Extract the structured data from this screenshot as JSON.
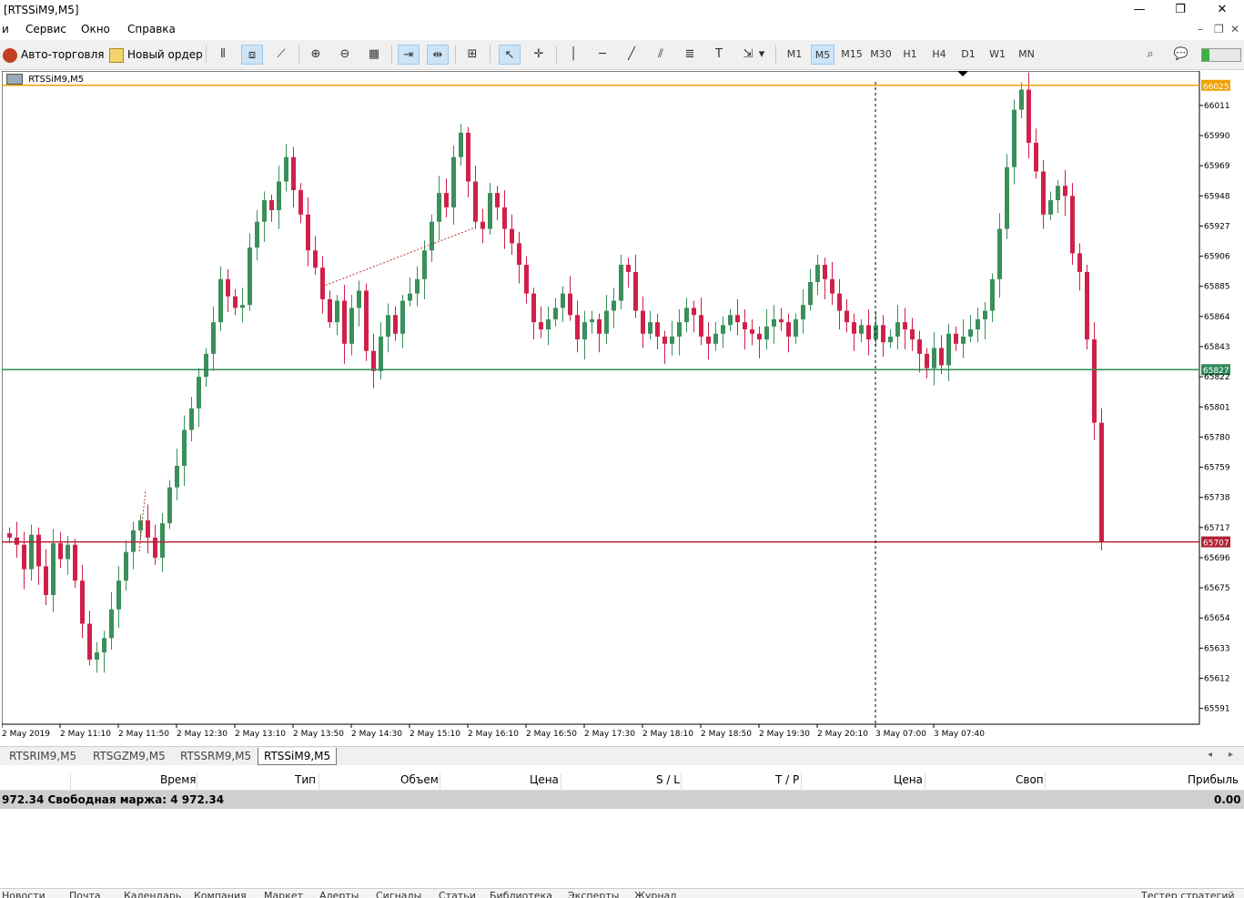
{
  "window": {
    "title": "[RTSSiM9,M5]",
    "minimize": "—",
    "restore": "❐",
    "close": "✕"
  },
  "menu": [
    "и",
    "Сервис",
    "Окно",
    "Справка"
  ],
  "toolbar": {
    "autotrade_label": "Авто-торговля",
    "new_order_label": "Новый ордер"
  },
  "timeframes": [
    "M1",
    "M5",
    "M15",
    "M30",
    "H1",
    "H4",
    "D1",
    "W1",
    "MN"
  ],
  "active_timeframe": "M5",
  "chart": {
    "symbol_label": "RTSSiM9,M5"
  },
  "chart_data": {
    "type": "candlestick",
    "ylim": [
      65580,
      66035
    ],
    "price_ticks": [
      66011,
      65990,
      65969,
      65948,
      65927,
      65906,
      65885,
      65864,
      65843,
      65822,
      65801,
      65780,
      65759,
      65738,
      65717,
      65696,
      65675,
      65654,
      65633,
      65612,
      65591
    ],
    "time_labels": [
      "2 May 2019",
      "2 May 11:10",
      "2 May 11:50",
      "2 May 12:30",
      "2 May 13:10",
      "2 May 13:50",
      "2 May 14:30",
      "2 May 15:10",
      "2 May 16:10",
      "2 May 16:50",
      "2 May 17:30",
      "2 May 18:10",
      "2 May 18:50",
      "2 May 19:30",
      "2 May 20:10",
      "3 May 07:00",
      "3 May 07:40"
    ],
    "hlines": [
      {
        "price": 66025,
        "label": "66025",
        "color": "#f0a000"
      },
      {
        "price": 65827,
        "label": "65827",
        "color": "#2e8b57"
      },
      {
        "price": 65707,
        "label": "65707",
        "color": "#b22234"
      }
    ],
    "colors": {
      "bull": "#3a8f5a",
      "bear": "#d0204a"
    },
    "closes": [
      65710,
      65705,
      65688,
      65712,
      65690,
      65670,
      65706,
      65695,
      65705,
      65680,
      65650,
      65625,
      65630,
      65640,
      65660,
      65680,
      65700,
      65715,
      65722,
      65710,
      65696,
      65720,
      65745,
      65760,
      65785,
      65800,
      65822,
      65838,
      65860,
      65890,
      65878,
      65870,
      65872,
      65912,
      65930,
      65945,
      65938,
      65958,
      65975,
      65952,
      65935,
      65910,
      65898,
      65876,
      65860,
      65875,
      65845,
      65870,
      65882,
      65840,
      65826,
      65850,
      65865,
      65852,
      65875,
      65880,
      65890,
      65910,
      65930,
      65950,
      65940,
      65975,
      65992,
      65958,
      65930,
      65925,
      65950,
      65940,
      65925,
      65915,
      65900,
      65880,
      65860,
      65855,
      65862,
      65870,
      65880,
      65865,
      65848,
      65860,
      65862,
      65852,
      65868,
      65875,
      65900,
      65895,
      65868,
      65852,
      65860,
      65850,
      65845,
      65850,
      65860,
      65870,
      65865,
      65850,
      65845,
      65852,
      65858,
      65865,
      65860,
      65855,
      65852,
      65848,
      65857,
      65862,
      65860,
      65850,
      65862,
      65872,
      65888,
      65900,
      65890,
      65880,
      65868,
      65860,
      65852,
      65858,
      65848,
      65858,
      65846,
      65850,
      65860,
      65855,
      65848,
      65838,
      65828,
      65842,
      65830,
      65852,
      65845,
      65850,
      65855,
      65862,
      65868,
      65890,
      65925,
      65968,
      66008,
      66022,
      65985,
      65965,
      65935,
      65945,
      65955,
      65948,
      65908,
      65895,
      65848,
      65790,
      65707
    ]
  },
  "symbol_tabs": [
    "RTSRIM9,M5",
    "RTSGZM9,M5",
    "RTSSRM9,M5",
    "RTSSiM9,M5"
  ],
  "active_symbol_tab": "RTSSiM9,M5",
  "trade_columns": [
    "Время",
    "Тип",
    "Объем",
    "Цена",
    "S / L",
    "T / P",
    "Цена",
    "Своп",
    "Прибыль"
  ],
  "balance": {
    "text": "972.34  Свободная маржа: 4 972.34",
    "profit": "0.00"
  },
  "bottom_tabs": [
    "Новости",
    "Почта",
    "Календарь",
    "Компания",
    "Маркет",
    "Алерты",
    "Сигналы",
    "Статьи",
    "Библиотека",
    "Эксперты",
    "Журнал",
    "Тестер стратегий"
  ]
}
